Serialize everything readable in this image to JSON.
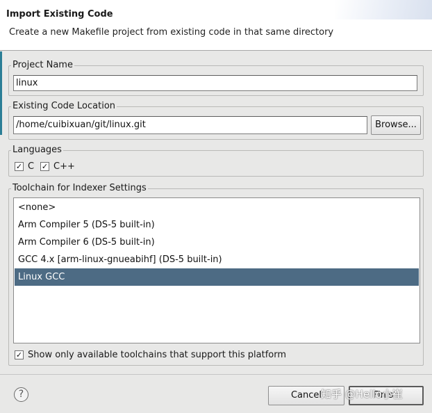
{
  "header": {
    "title": "Import Existing Code",
    "description": "Create a new Makefile project from existing code in that same directory"
  },
  "project_name": {
    "label": "Project Name",
    "value": "linux"
  },
  "code_location": {
    "label": "Existing Code Location",
    "value": "/home/cuibixuan/git/linux.git",
    "browse_label": "Browse..."
  },
  "languages": {
    "label": "Languages",
    "items": [
      {
        "label": "C",
        "checked": true
      },
      {
        "label": "C++",
        "checked": true
      }
    ]
  },
  "toolchain": {
    "label": "Toolchain for Indexer Settings",
    "items": [
      {
        "label": "<none>",
        "selected": false
      },
      {
        "label": "Arm Compiler 5 (DS-5 built-in)",
        "selected": false
      },
      {
        "label": "Arm Compiler 6 (DS-5 built-in)",
        "selected": false
      },
      {
        "label": "GCC 4.x [arm-linux-gnueabihf] (DS-5 built-in)",
        "selected": false
      },
      {
        "label": "Linux GCC",
        "selected": true
      }
    ],
    "show_only_label": "Show only available toolchains that support this platform",
    "show_only_checked": true
  },
  "footer": {
    "help_glyph": "?",
    "cancel_label": "Cancel",
    "finish_label": "Finish"
  },
  "watermark": "知乎 @Hello小崔",
  "colors": {
    "selection": "#4d6b84",
    "accent_strip": "#2b7e96"
  }
}
